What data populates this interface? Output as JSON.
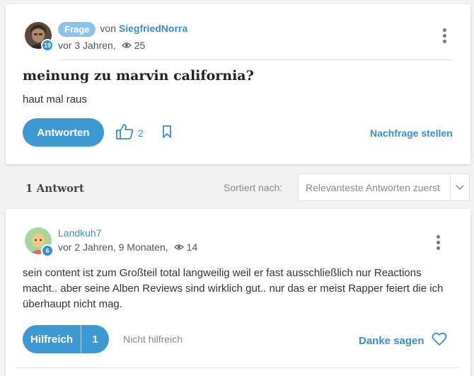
{
  "colors": {
    "accent": "#3e98d2",
    "link": "#3a8dc4",
    "tag": "#8cc2e6",
    "page_bg": "#f2f2f2"
  },
  "question": {
    "tag": "Frage",
    "by_prefix": "von",
    "author": "SiegfriedNorra",
    "author_rank": "19",
    "age": "vor 3 Jahren,",
    "views": "25",
    "title": "meinung zu marvin california?",
    "body": "haut mal raus",
    "answer_button": "Antworten",
    "likes": "2",
    "followup_link": "Nachfrage stellen",
    "icons": [
      "more-vertical-icon",
      "eye-icon",
      "thumbs-up-icon",
      "bookmark-icon"
    ]
  },
  "answers_header": {
    "count_label": "1 Antwort",
    "sort_label": "Sortiert nach:",
    "sort_value": "Relevanteste Antworten zuerst",
    "icons": [
      "chevron-down-icon"
    ]
  },
  "answer": {
    "author": "Landkuh7",
    "author_rank": "6",
    "age": "vor 2 Jahren, 9 Monaten,",
    "views": "14",
    "body": "sein content ist zum Großteil total langweilig weil er fast ausschließlich nur Reactions macht.. aber seine Alben Reviews sind wirklich gut.. nur das er meist Rapper feiert die ich überhaupt nicht mag.",
    "helpful_label": "Hilfreich",
    "helpful_count": "1",
    "not_helpful_label": "Nicht hilfreich",
    "thanks_label": "Danke sagen",
    "icons": [
      "more-vertical-icon",
      "eye-icon",
      "heart-icon"
    ]
  }
}
